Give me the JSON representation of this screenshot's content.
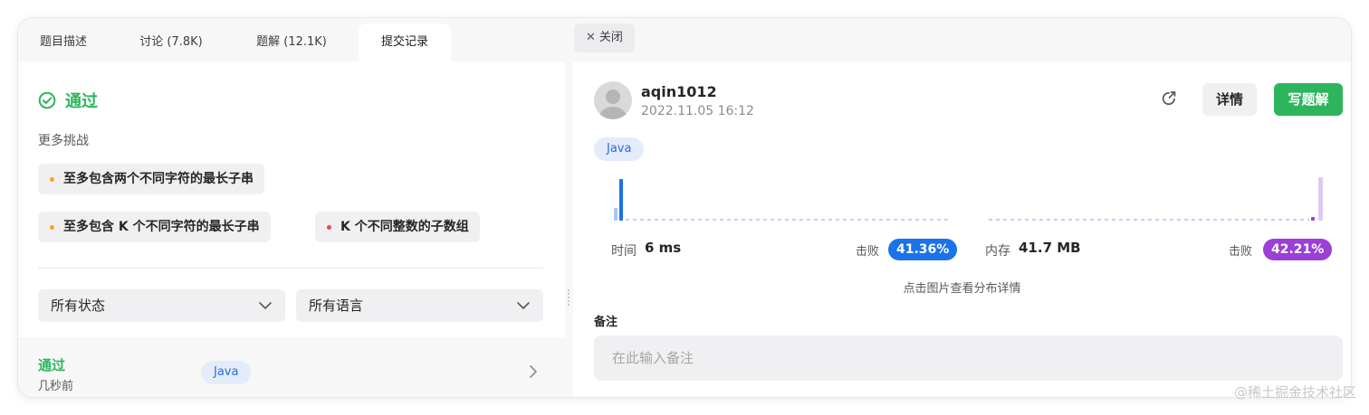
{
  "tabs": [
    {
      "label": "题目描述"
    },
    {
      "label": "讨论 (7.8K)"
    },
    {
      "label": "题解 (12.1K)"
    },
    {
      "label": "提交记录"
    }
  ],
  "result": {
    "status": "通过",
    "more_label": "更多挑战",
    "challenges": [
      {
        "label": "至多包含两个不同字符的最长子串",
        "dot_color": "#ffa116"
      },
      {
        "label": "至多包含 K 个不同字符的最长子串",
        "dot_color": "#ffa116"
      },
      {
        "label": "K 个不同整数的子数组",
        "dot_color": "#ef4743"
      }
    ]
  },
  "filters": {
    "status_select": "所有状态",
    "language_select": "所有语言"
  },
  "submission": {
    "status": "通过",
    "time": "几秒前",
    "language": "Java"
  },
  "close_button": "关闭",
  "detail": {
    "username": "aqin1012",
    "datetime": "2022.11.05 16:12",
    "detail_button": "详情",
    "write_button": "写题解",
    "language": "Java",
    "runtime": {
      "label": "时间",
      "value": "6 ms",
      "beat_label": "击败",
      "beat": "41.36%",
      "color": "#1a73e8"
    },
    "memory": {
      "label": "内存",
      "value": "41.7 MB",
      "beat_label": "击败",
      "beat": "42.21%",
      "color": "#9b3fd6"
    },
    "hint": "点击图片查看分布详情",
    "notes_label": "备注",
    "notes_placeholder": "在此输入备注"
  },
  "watermark": "@稀土掘金技术社区",
  "colors": {
    "accent_green": "#2db55d",
    "pill_bg": "#e3ecfb",
    "pill_text": "#2f6bd6"
  }
}
